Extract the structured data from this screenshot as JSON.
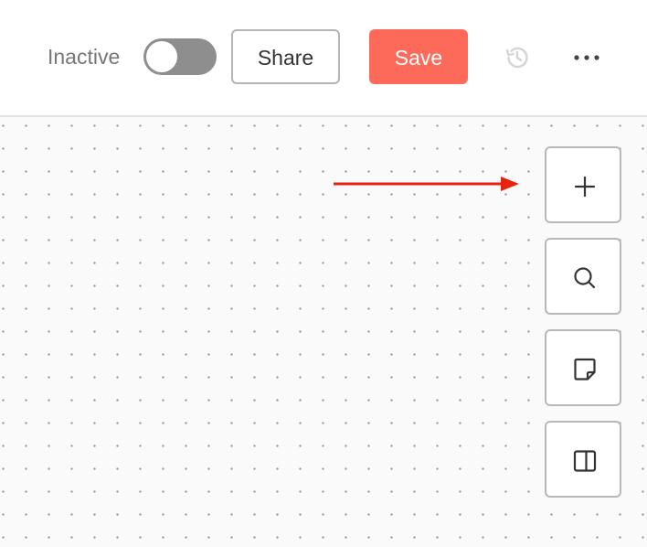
{
  "header": {
    "status_label": "Inactive",
    "active_toggle": {
      "on": false
    },
    "share_label": "Share",
    "save_label": "Save",
    "history_icon": "history-icon",
    "more_icon": "more-horizontal-icon"
  },
  "canvas": {
    "background": "dot-grid",
    "tools": [
      {
        "name": "add-node",
        "icon": "plus-icon"
      },
      {
        "name": "search",
        "icon": "search-icon"
      },
      {
        "name": "sticky-note",
        "icon": "note-icon"
      },
      {
        "name": "toggle-panel",
        "icon": "panel-icon"
      }
    ]
  },
  "colors": {
    "accent": "#fd6a5a",
    "annotation_arrow": "#e8220f",
    "toggle_off": "#8e8e8e",
    "muted_text": "#777777"
  }
}
